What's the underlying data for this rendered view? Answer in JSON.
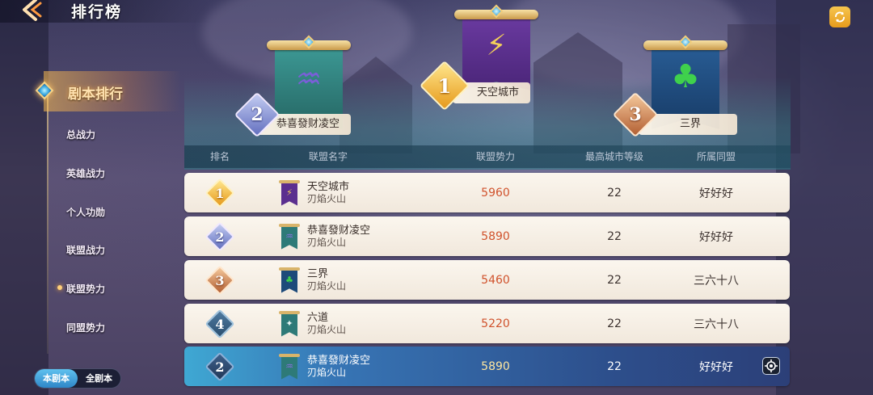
{
  "header": {
    "title": "排行榜"
  },
  "sidebar": {
    "active": "剧本排行",
    "items": [
      "总战力",
      "英雄战力",
      "个人功勋",
      "联盟战力",
      "联盟势力",
      "同盟势力"
    ]
  },
  "scope_toggle": {
    "options": [
      "本剧本",
      "全剧本"
    ],
    "selected": "本剧本"
  },
  "podium": [
    {
      "rank": "1",
      "name": "天空城市",
      "emblem": "⚡",
      "cloth_color": "#5b2f8f"
    },
    {
      "rank": "2",
      "name": "恭喜發财凌空",
      "emblem": "♒",
      "cloth_color": "#2e7a78"
    },
    {
      "rank": "3",
      "name": "三界",
      "emblem": "♣",
      "cloth_color": "#1d4a7a"
    }
  ],
  "table": {
    "headers": [
      "排名",
      "联盟名字",
      "联盟势力",
      "最高城市等级",
      "所属同盟"
    ],
    "rows": [
      {
        "rank": "1",
        "name": "天空城市",
        "server": "刃焰火山",
        "power": "5960",
        "level": "22",
        "group": "好好好"
      },
      {
        "rank": "2",
        "name": "恭喜發财凌空",
        "server": "刃焰火山",
        "power": "5890",
        "level": "22",
        "group": "好好好"
      },
      {
        "rank": "3",
        "name": "三界",
        "server": "刃焰火山",
        "power": "5460",
        "level": "22",
        "group": "三六十八"
      },
      {
        "rank": "4",
        "name": "六道",
        "server": "刃焰火山",
        "power": "5220",
        "level": "22",
        "group": "三六十八"
      }
    ],
    "self_row": {
      "rank": "2",
      "name": "恭喜發财凌空",
      "server": "刃焰火山",
      "power": "5890",
      "level": "22",
      "group": "好好好"
    }
  },
  "colors": {
    "gold": "#f2b636",
    "silver": "#7f88c9",
    "bronze": "#b86b3c",
    "self_row": "#2d4f8c"
  }
}
